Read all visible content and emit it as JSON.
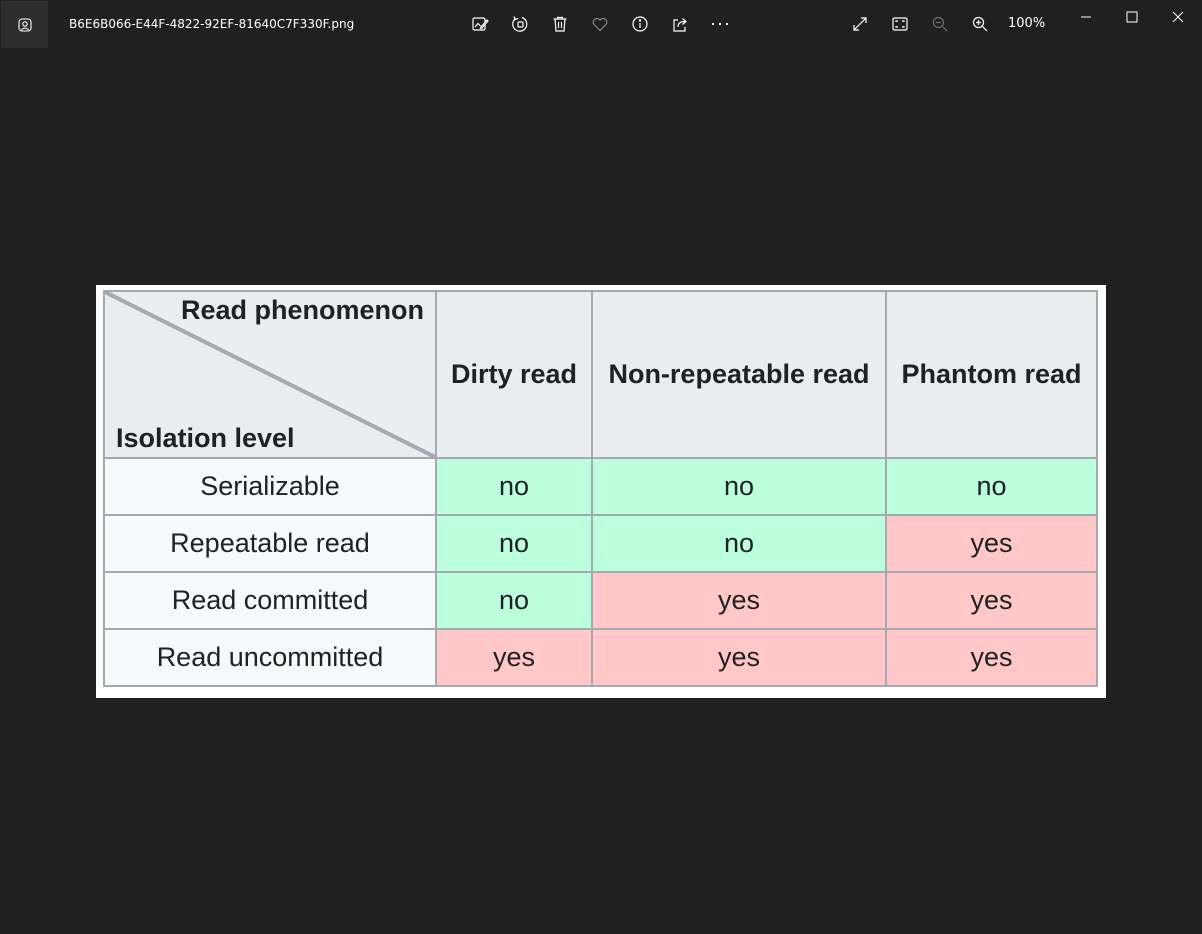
{
  "window": {
    "filename": "B6E6B066-E44F-4822-92EF-81640C7F330F.png",
    "zoom_level": "100%"
  },
  "toolbar": {
    "icons": [
      "edit-image-icon",
      "rotate-icon",
      "delete-icon",
      "favorite-icon",
      "info-icon",
      "share-icon",
      "more-icon",
      "fullscreen-icon",
      "fit-window-icon",
      "zoom-out-icon",
      "zoom-in-icon"
    ]
  },
  "colors": {
    "no_cell": "#bbffdd",
    "yes_cell": "#ffc7c7",
    "header_bg": "#eaecf0",
    "row_label_bg": "#f8f9fa",
    "app_bg": "#202020"
  },
  "table": {
    "corner_top": "Read phenomenon",
    "corner_bottom": "Isolation level",
    "columns": [
      "Dirty read",
      "Non-repeatable read",
      "Phantom read"
    ],
    "rows": [
      {
        "label": "Serializable",
        "values": [
          "no",
          "no",
          "no"
        ]
      },
      {
        "label": "Repeatable read",
        "values": [
          "no",
          "no",
          "yes"
        ]
      },
      {
        "label": "Read committed",
        "values": [
          "no",
          "yes",
          "yes"
        ]
      },
      {
        "label": "Read uncommitted",
        "values": [
          "yes",
          "yes",
          "yes"
        ]
      }
    ]
  }
}
